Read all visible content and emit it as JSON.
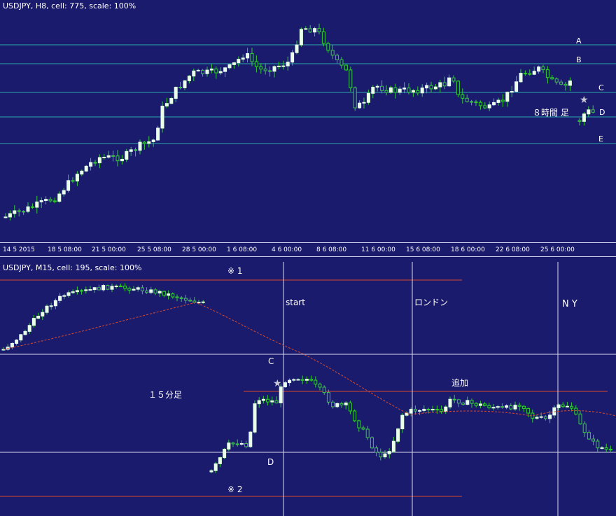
{
  "colors": {
    "background": "#1b1b6e",
    "bull_fill": "#e8ffe8",
    "wick": "#33cc33",
    "top_level_line": "#2aa9a9",
    "red_line": "#d84a2a",
    "ma_line": "#d84a2a",
    "white_line": "#d8d8f0",
    "star": "#c8c8d8"
  },
  "top_panel": {
    "header": "USDJPY, H8, cell: 775, scale: 100%",
    "level_labels": [
      "A",
      "B",
      "C",
      "D",
      "E"
    ],
    "annotation": "８時間 足",
    "star_icon": "star-icon",
    "time_axis": [
      "14 5 2015",
      "18 5 08:00",
      "21 5 00:00",
      "25 5 08:00",
      "28 5 00:00",
      "1 6 08:00",
      "4 6 00:00",
      "8 6 08:00",
      "11 6 00:00",
      "15 6 08:00",
      "18 6 00:00",
      "22 6 08:00",
      "25 6 00:00"
    ]
  },
  "bottom_panel": {
    "header": "USDJPY, M15, cell: 195, scale: 100%",
    "labels": {
      "note1": "※ 1",
      "note2": "※ 2",
      "start": "start",
      "london": "ロンドン",
      "ny": "N Y",
      "c": "C",
      "d": "D",
      "tsuika": "追加",
      "tf": "１５分足"
    },
    "star_icon": "star-icon"
  }
}
